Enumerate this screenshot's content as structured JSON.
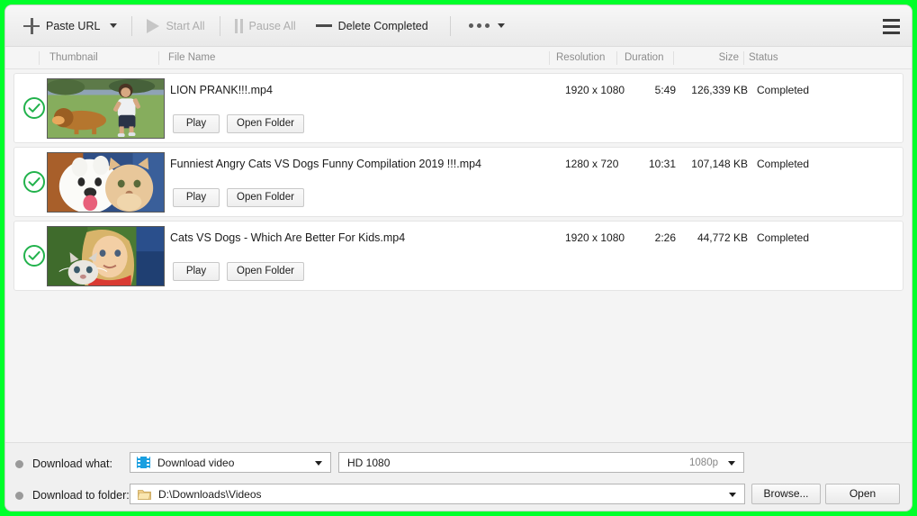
{
  "toolbar": {
    "paste_url": "Paste URL",
    "start_all": "Start All",
    "pause_all": "Pause All",
    "delete_completed": "Delete Completed",
    "more_icon": "more-options",
    "menu_icon": "hamburger-menu"
  },
  "columns": {
    "thumbnail": "Thumbnail",
    "file_name": "File Name",
    "resolution": "Resolution",
    "duration": "Duration",
    "size": "Size",
    "status": "Status"
  },
  "row_buttons": {
    "play": "Play",
    "open_folder": "Open Folder"
  },
  "downloads": [
    {
      "file_name": "LION PRANK!!!.mp4",
      "resolution": "1920 x 1080",
      "duration": "5:49",
      "size": "126,339 KB",
      "status": "Completed",
      "status_icon": "check-circle"
    },
    {
      "file_name": "Funniest Angry Cats VS Dogs Funny Compilation 2019 !!!.mp4",
      "resolution": "1280 x 720",
      "duration": "10:31",
      "size": "107,148 KB",
      "status": "Completed",
      "status_icon": "check-circle"
    },
    {
      "file_name": "Cats VS Dogs - Which Are Better For Kids.mp4",
      "resolution": "1920 x 1080",
      "duration": "2:26",
      "size": "44,772 KB",
      "status": "Completed",
      "status_icon": "check-circle"
    }
  ],
  "bottom": {
    "download_what_label": "Download what:",
    "download_what_value": "Download video",
    "download_what_icon": "film-strip-icon",
    "quality_value": "HD 1080",
    "quality_suffix": "1080p",
    "download_to_folder_label": "Download to folder:",
    "folder_value": "D:\\Downloads\\Videos",
    "folder_icon": "folder-icon",
    "browse_label": "Browse...",
    "open_label": "Open"
  },
  "colors": {
    "highlight_border": "#00ff2a",
    "status_ok": "#22b24c",
    "accent_blue": "#1a9fe0",
    "window_bg": "#f1f1f1"
  }
}
